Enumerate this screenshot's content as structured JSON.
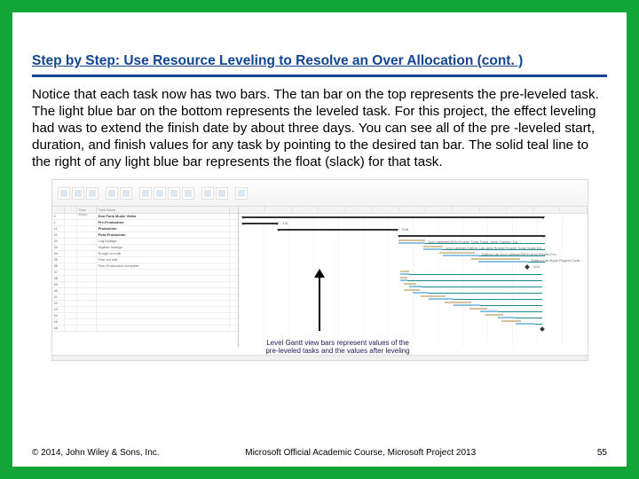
{
  "title": "Step by Step: Use Resource Leveling to Resolve an Over Allocation (cont. )",
  "body": "Notice that each task now has two bars. The tan bar on the top represents the pre-leveled task. The light blue bar on the bottom represents the leveled task. For this project, the effect leveling had was to extend the finish date by about three days. You can see all of the pre -leveled start, duration, and finish values for any task by pointing to the desired tan bar. The solid teal line to the right of any light blue bar represents the float (slack) for that task.",
  "grid": {
    "headers": [
      "",
      "",
      "Task Mode",
      "Task Name"
    ],
    "rows": [
      {
        "id": "0",
        "ind": "",
        "mode": "",
        "name": "Don Funk Music Video",
        "bold": true
      },
      {
        "id": "1",
        "ind": "",
        "mode": "",
        "name": "Pre-Production",
        "bold": true
      },
      {
        "id": "11",
        "ind": "",
        "mode": "",
        "name": "Production",
        "bold": true
      },
      {
        "id": "31",
        "ind": "",
        "mode": "",
        "name": "Post-Production",
        "bold": true
      },
      {
        "id": "32",
        "ind": "",
        "mode": "",
        "name": "  Log footage"
      },
      {
        "id": "33",
        "ind": "",
        "mode": "",
        "name": "  Digitize footage"
      },
      {
        "id": "34",
        "ind": "",
        "mode": "",
        "name": "  Rough cut edit"
      },
      {
        "id": "35",
        "ind": "",
        "mode": "",
        "name": "  Fine cut edit"
      },
      {
        "id": "36",
        "ind": "",
        "mode": "",
        "name": "  Post-Production complete"
      },
      {
        "id": "37",
        "ind": "",
        "mode": "",
        "name": ""
      },
      {
        "id": "38",
        "ind": "",
        "mode": "",
        "name": ""
      },
      {
        "id": "39",
        "ind": "",
        "mode": "",
        "name": ""
      },
      {
        "id": "40",
        "ind": "",
        "mode": "",
        "name": ""
      },
      {
        "id": "41",
        "ind": "",
        "mode": "",
        "name": ""
      },
      {
        "id": "42",
        "ind": "",
        "mode": "",
        "name": ""
      },
      {
        "id": "43",
        "ind": "",
        "mode": "",
        "name": ""
      },
      {
        "id": "44",
        "ind": "",
        "mode": "",
        "name": ""
      },
      {
        "id": "45",
        "ind": "",
        "mode": "",
        "name": ""
      },
      {
        "id": "46",
        "ind": "",
        "mode": "",
        "name": ""
      }
    ]
  },
  "callout": {
    "line1": "Level Gantt view bars represent values of the",
    "line2": "pre-leveled tasks and the values after leveling"
  },
  "footer": {
    "copyright": "© 2014, John Wiley & Sons, Inc.",
    "course": "Microsoft Official Academic Course, Microsoft Project 2013",
    "page": "55"
  }
}
